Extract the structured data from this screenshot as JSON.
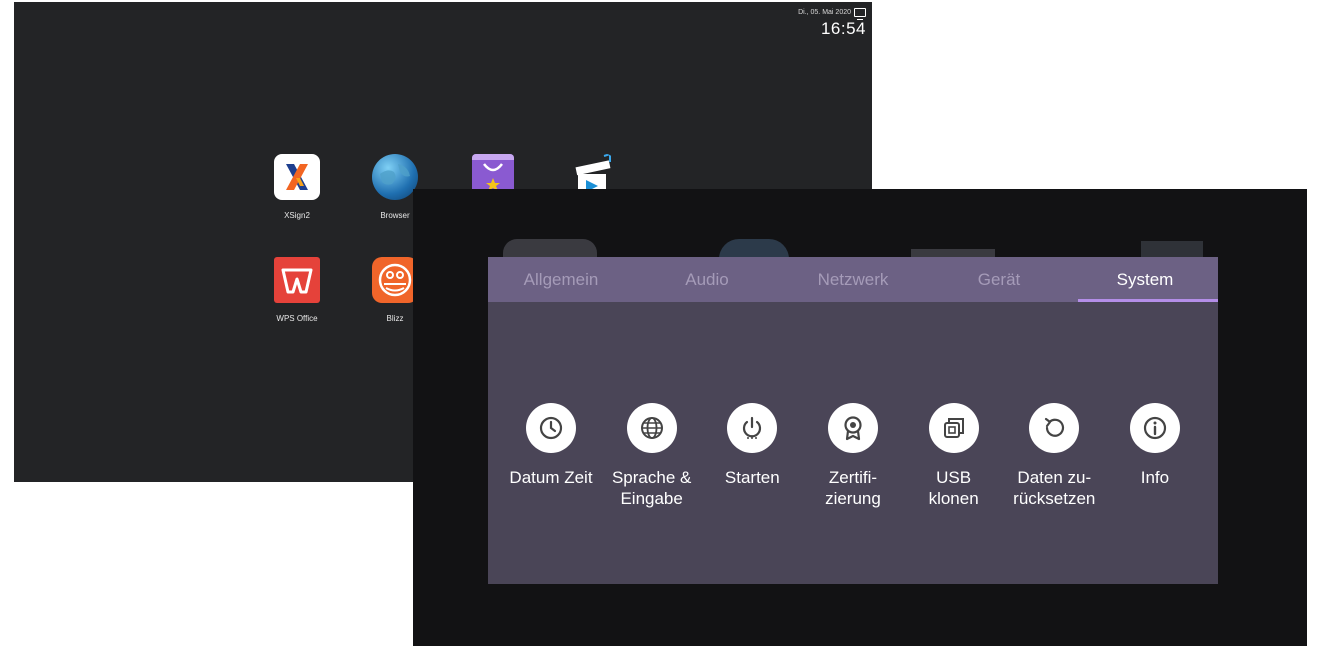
{
  "launcher": {
    "status": {
      "date": "Di., 05. Mai 2020",
      "time": "16:54",
      "display_icon": "monitor-icon"
    },
    "apps": [
      {
        "label": "XSign2",
        "icon": "xsign-icon"
      },
      {
        "label": "Browser",
        "icon": "globe-icon"
      },
      {
        "label": "",
        "icon": "store-icon"
      },
      {
        "label": "",
        "icon": "media-player-icon"
      },
      {
        "label": "WPS Office",
        "icon": "wps-office-icon"
      },
      {
        "label": "Blizz",
        "icon": "blizz-icon"
      }
    ]
  },
  "settings": {
    "tabs": [
      {
        "label": "Allgemein",
        "active": false
      },
      {
        "label": "Audio",
        "active": false
      },
      {
        "label": "Netzwerk",
        "active": false
      },
      {
        "label": "Gerät",
        "active": false
      },
      {
        "label": "System",
        "active": true
      }
    ],
    "options": [
      {
        "label": "Datum Zeit",
        "icon": "clock-icon"
      },
      {
        "label": "Sprache &\nEingabe",
        "icon": "globe-icon"
      },
      {
        "label": "Starten",
        "icon": "power-icon"
      },
      {
        "label": "Zertifi-\nzierung",
        "icon": "certificate-icon"
      },
      {
        "label": "USB\nklonen",
        "icon": "usb-clone-icon"
      },
      {
        "label": "Daten zu-\nrücksetzen",
        "icon": "reset-icon"
      },
      {
        "label": "Info",
        "icon": "info-icon"
      }
    ]
  },
  "colors": {
    "accent": "#b48ee8",
    "tab_bar": "#6c6184",
    "panel": "#4a4557",
    "launcher_bg": "#232426"
  }
}
